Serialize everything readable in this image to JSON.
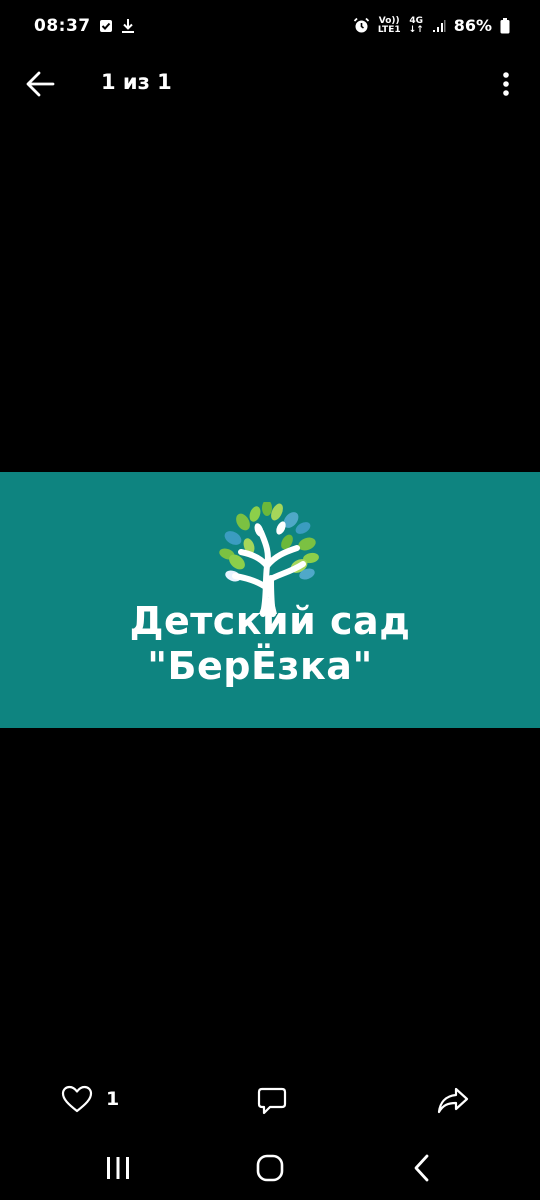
{
  "status_bar": {
    "time": "08:37",
    "volte_top": "Vo))",
    "volte_bottom": "LTE1",
    "network_top": "4G",
    "network_bottom": "↓↑",
    "battery": "86%",
    "icons": [
      "shield-check-icon",
      "download-icon",
      "alarm-icon",
      "volte-icon",
      "network-icon",
      "signal-icon",
      "battery-icon"
    ]
  },
  "top_bar": {
    "counter": "1 из 1",
    "icons": [
      "back-arrow-icon",
      "more-vert-icon"
    ]
  },
  "image": {
    "line1": "Детский сад",
    "line2": "\"БерЁзка\"",
    "background": "#0e8480",
    "icons": [
      "tree-logo-icon"
    ]
  },
  "actions": {
    "like_count": "1",
    "icons": [
      "heart-icon",
      "comment-icon",
      "share-icon"
    ]
  },
  "nav_bar": {
    "icons": [
      "recents-icon",
      "home-icon",
      "nav-back-icon"
    ]
  }
}
